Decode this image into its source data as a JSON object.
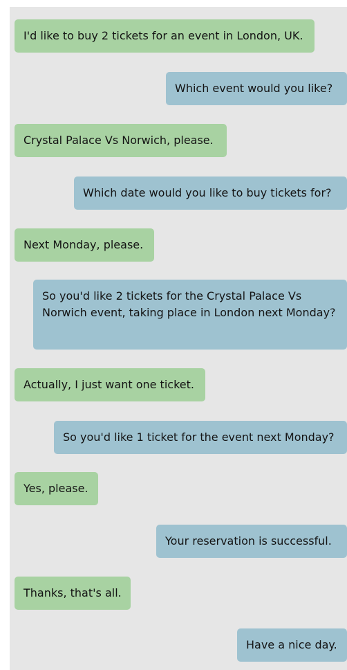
{
  "conversation": {
    "messages": [
      {
        "sender": "user",
        "text": "I'd like to buy 2 tickets for an event in London, UK."
      },
      {
        "sender": "system",
        "text": "Which event would you like?"
      },
      {
        "sender": "user",
        "text": "Crystal Palace Vs Norwich, please."
      },
      {
        "sender": "system",
        "text": "Which date would you like to buy tickets for?"
      },
      {
        "sender": "user",
        "text": "Next Monday, please."
      },
      {
        "sender": "system",
        "text": "So you'd like 2 tickets for the Crystal Palace Vs Norwich event, taking place in London next Monday?"
      },
      {
        "sender": "user",
        "text": "Actually, I just want one ticket."
      },
      {
        "sender": "system",
        "text": "So you'd like 1 ticket for the event next Monday?"
      },
      {
        "sender": "user",
        "text": "Yes, please."
      },
      {
        "sender": "system",
        "text": "Your reservation is successful."
      },
      {
        "sender": "user",
        "text": "Thanks, that's all."
      },
      {
        "sender": "system",
        "text": "Have a nice day."
      }
    ]
  },
  "colors": {
    "background": "#e6e6e6",
    "user_bubble": "#a8d2a2",
    "system_bubble": "#9ec2d0",
    "text": "#141414"
  }
}
